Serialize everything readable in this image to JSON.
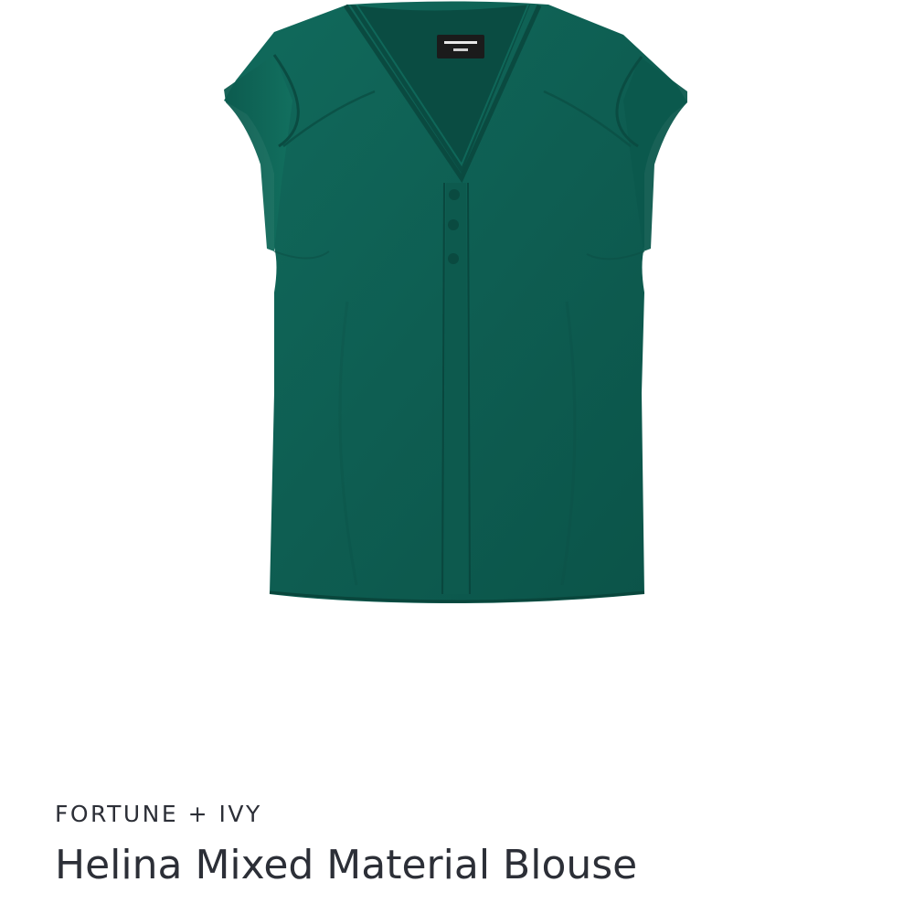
{
  "product": {
    "brand": "FORTUNE + IVY",
    "name": "Helina Mixed Material Blouse",
    "image": {
      "subject": "blouse",
      "icon": "blouse-photo",
      "color": "#0f5f53"
    }
  },
  "colors": {
    "text": "#2c2f37",
    "background": "#ffffff"
  }
}
